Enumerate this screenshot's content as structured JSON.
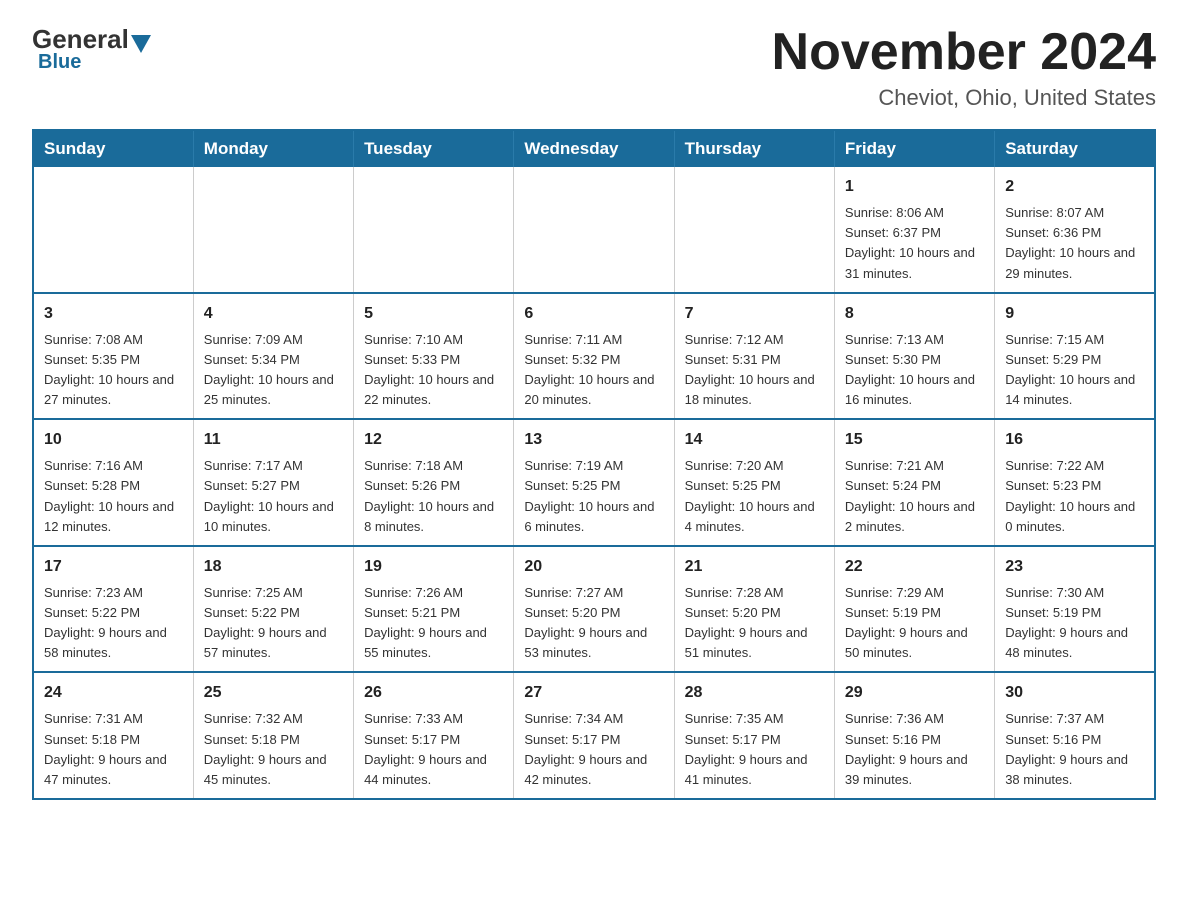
{
  "header": {
    "logo_general": "General",
    "logo_blue": "Blue",
    "main_title": "November 2024",
    "subtitle": "Cheviot, Ohio, United States"
  },
  "calendar": {
    "weekdays": [
      "Sunday",
      "Monday",
      "Tuesday",
      "Wednesday",
      "Thursday",
      "Friday",
      "Saturday"
    ],
    "weeks": [
      [
        {
          "day": "",
          "info": ""
        },
        {
          "day": "",
          "info": ""
        },
        {
          "day": "",
          "info": ""
        },
        {
          "day": "",
          "info": ""
        },
        {
          "day": "",
          "info": ""
        },
        {
          "day": "1",
          "info": "Sunrise: 8:06 AM\nSunset: 6:37 PM\nDaylight: 10 hours and 31 minutes."
        },
        {
          "day": "2",
          "info": "Sunrise: 8:07 AM\nSunset: 6:36 PM\nDaylight: 10 hours and 29 minutes."
        }
      ],
      [
        {
          "day": "3",
          "info": "Sunrise: 7:08 AM\nSunset: 5:35 PM\nDaylight: 10 hours and 27 minutes."
        },
        {
          "day": "4",
          "info": "Sunrise: 7:09 AM\nSunset: 5:34 PM\nDaylight: 10 hours and 25 minutes."
        },
        {
          "day": "5",
          "info": "Sunrise: 7:10 AM\nSunset: 5:33 PM\nDaylight: 10 hours and 22 minutes."
        },
        {
          "day": "6",
          "info": "Sunrise: 7:11 AM\nSunset: 5:32 PM\nDaylight: 10 hours and 20 minutes."
        },
        {
          "day": "7",
          "info": "Sunrise: 7:12 AM\nSunset: 5:31 PM\nDaylight: 10 hours and 18 minutes."
        },
        {
          "day": "8",
          "info": "Sunrise: 7:13 AM\nSunset: 5:30 PM\nDaylight: 10 hours and 16 minutes."
        },
        {
          "day": "9",
          "info": "Sunrise: 7:15 AM\nSunset: 5:29 PM\nDaylight: 10 hours and 14 minutes."
        }
      ],
      [
        {
          "day": "10",
          "info": "Sunrise: 7:16 AM\nSunset: 5:28 PM\nDaylight: 10 hours and 12 minutes."
        },
        {
          "day": "11",
          "info": "Sunrise: 7:17 AM\nSunset: 5:27 PM\nDaylight: 10 hours and 10 minutes."
        },
        {
          "day": "12",
          "info": "Sunrise: 7:18 AM\nSunset: 5:26 PM\nDaylight: 10 hours and 8 minutes."
        },
        {
          "day": "13",
          "info": "Sunrise: 7:19 AM\nSunset: 5:25 PM\nDaylight: 10 hours and 6 minutes."
        },
        {
          "day": "14",
          "info": "Sunrise: 7:20 AM\nSunset: 5:25 PM\nDaylight: 10 hours and 4 minutes."
        },
        {
          "day": "15",
          "info": "Sunrise: 7:21 AM\nSunset: 5:24 PM\nDaylight: 10 hours and 2 minutes."
        },
        {
          "day": "16",
          "info": "Sunrise: 7:22 AM\nSunset: 5:23 PM\nDaylight: 10 hours and 0 minutes."
        }
      ],
      [
        {
          "day": "17",
          "info": "Sunrise: 7:23 AM\nSunset: 5:22 PM\nDaylight: 9 hours and 58 minutes."
        },
        {
          "day": "18",
          "info": "Sunrise: 7:25 AM\nSunset: 5:22 PM\nDaylight: 9 hours and 57 minutes."
        },
        {
          "day": "19",
          "info": "Sunrise: 7:26 AM\nSunset: 5:21 PM\nDaylight: 9 hours and 55 minutes."
        },
        {
          "day": "20",
          "info": "Sunrise: 7:27 AM\nSunset: 5:20 PM\nDaylight: 9 hours and 53 minutes."
        },
        {
          "day": "21",
          "info": "Sunrise: 7:28 AM\nSunset: 5:20 PM\nDaylight: 9 hours and 51 minutes."
        },
        {
          "day": "22",
          "info": "Sunrise: 7:29 AM\nSunset: 5:19 PM\nDaylight: 9 hours and 50 minutes."
        },
        {
          "day": "23",
          "info": "Sunrise: 7:30 AM\nSunset: 5:19 PM\nDaylight: 9 hours and 48 minutes."
        }
      ],
      [
        {
          "day": "24",
          "info": "Sunrise: 7:31 AM\nSunset: 5:18 PM\nDaylight: 9 hours and 47 minutes."
        },
        {
          "day": "25",
          "info": "Sunrise: 7:32 AM\nSunset: 5:18 PM\nDaylight: 9 hours and 45 minutes."
        },
        {
          "day": "26",
          "info": "Sunrise: 7:33 AM\nSunset: 5:17 PM\nDaylight: 9 hours and 44 minutes."
        },
        {
          "day": "27",
          "info": "Sunrise: 7:34 AM\nSunset: 5:17 PM\nDaylight: 9 hours and 42 minutes."
        },
        {
          "day": "28",
          "info": "Sunrise: 7:35 AM\nSunset: 5:17 PM\nDaylight: 9 hours and 41 minutes."
        },
        {
          "day": "29",
          "info": "Sunrise: 7:36 AM\nSunset: 5:16 PM\nDaylight: 9 hours and 39 minutes."
        },
        {
          "day": "30",
          "info": "Sunrise: 7:37 AM\nSunset: 5:16 PM\nDaylight: 9 hours and 38 minutes."
        }
      ]
    ]
  }
}
